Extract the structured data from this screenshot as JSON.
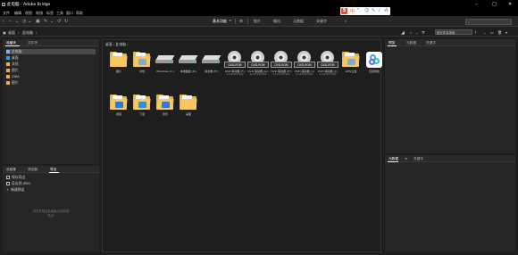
{
  "window": {
    "title": "此电脑 - Adobe Bridge",
    "controls": [
      "–",
      "□",
      "✕"
    ]
  },
  "menu": [
    "文件",
    "编辑",
    "视图",
    "堆栈",
    "标签",
    "工具",
    "窗口",
    "帮助"
  ],
  "workspace_tabs": [
    {
      "label": "基本功能",
      "active": true
    },
    {
      "label": "库",
      "active": false
    },
    {
      "label": "胶片",
      "active": false
    },
    {
      "label": "输出",
      "active": false
    },
    {
      "label": "元数据",
      "active": false
    },
    {
      "label": "关键字",
      "active": false
    }
  ],
  "workspace_more": "»",
  "ime": {
    "s_logo": "S",
    "items": [
      "中",
      "°,",
      "☺",
      "✎",
      "♪",
      "⁂"
    ]
  },
  "sort_label": "按文件名排序",
  "search_placeholder": "",
  "pathbar": {
    "crumb1": "桌面",
    "sep": "›",
    "crumb2": "此电脑",
    "sep2": "›"
  },
  "left_top": {
    "tabs": [
      {
        "label": "收藏夹"
      },
      {
        "label": "文件夹"
      }
    ],
    "items": [
      {
        "label": "此电脑",
        "color": "#6fb6ff"
      },
      {
        "label": "桌面",
        "color": "#3a9de0"
      },
      {
        "label": "文档",
        "color": "#e8b44a"
      },
      {
        "label": "图片",
        "color": "#e8b44a"
      },
      {
        "label": "ZIKA",
        "color": "#e8b44a"
      },
      {
        "label": "图片",
        "color": "#e8b44a"
      }
    ]
  },
  "left_bot": {
    "tabs": [
      {
        "label": "收藏集"
      },
      {
        "label": "筛选器"
      },
      {
        "label": "导出"
      }
    ],
    "items": [
      {
        "label": "保存导出"
      },
      {
        "label": "导出到 JPEG"
      },
      {
        "label": "新建预设"
      }
    ],
    "placeholder1": "将文件拖至此面板以添加到",
    "placeholder2": "队列"
  },
  "center": {
    "path": "桌面 › 此电脑 ›",
    "items_row1": [
      {
        "type": "folder",
        "label": "图片",
        "sub": ""
      },
      {
        "type": "folder-doc",
        "label": "文档",
        "sub": ""
      },
      {
        "type": "drive-win",
        "label": "Windows (C:)",
        "sub": ""
      },
      {
        "type": "drive",
        "label": "本地磁盘 (D:)",
        "sub": ""
      },
      {
        "type": "drive",
        "label": "新加卷 (E:)",
        "sub": ""
      },
      {
        "type": "dvd",
        "label": "DVD 驱动器 (F:)",
        "sub": "4,129,204,992"
      },
      {
        "type": "dvd",
        "label": "DVD 驱动器 (G:)",
        "sub": "4,129,204,992"
      },
      {
        "type": "dvd",
        "label": "DVD 驱动器 (H:)",
        "sub": "4,129,204,992"
      },
      {
        "type": "dvd",
        "label": "DVD 驱动器 (I:)",
        "sub": "4,129,204,992"
      },
      {
        "type": "dvd",
        "label": "DVD 驱动器 (J:)",
        "sub": "4,129,204,992"
      },
      {
        "type": "folder-doc",
        "label": "WPS云盘",
        "sub": ""
      },
      {
        "type": "app",
        "label": "百度网盘",
        "sub": ""
      }
    ],
    "items_row2": [
      {
        "type": "folder-video",
        "label": "视频",
        "sub": ""
      },
      {
        "type": "folder-down",
        "label": "下载",
        "sub": ""
      },
      {
        "type": "folder-music",
        "label": "音乐",
        "sub": ""
      },
      {
        "type": "folder",
        "label": "桌面",
        "sub": ""
      }
    ],
    "dvd_text": "DVD-ROM"
  },
  "right_top": {
    "tabs": [
      {
        "label": "预览"
      },
      {
        "label": "元数据"
      },
      {
        "label": "关键字"
      }
    ]
  },
  "right_bot": {
    "tabs": [
      {
        "label": "元数据"
      },
      {
        "label": "关键字"
      }
    ],
    "menu_glyph": "≡"
  }
}
